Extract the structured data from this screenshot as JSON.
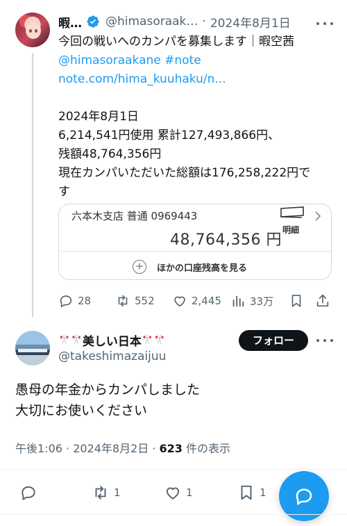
{
  "parent_tweet": {
    "name": "暇…",
    "handle": "@himasoraak…",
    "dot": "·",
    "date": "2024年8月1日",
    "lines": [
      "今回の戦いへのカンパを募集します｜暇空茜",
      "@himasoraakane #note",
      "note.com/hima_kuuhaku/n...",
      "",
      "2024年8月1日",
      "6,214,541円使用 累計127,493,866円、",
      "残額48,764,356円",
      "現在カンパいただいた総額は176,258,222円で",
      "す"
    ],
    "card": {
      "account": "六本木支店 普通 0969443",
      "balance": "48,764,356 円",
      "detail": "明細",
      "other_accounts": "ほかの口座残高を見る"
    },
    "actions": {
      "replies": "28",
      "retweets": "552",
      "likes": "2,445",
      "views": "33万"
    }
  },
  "main_tweet": {
    "flags": "🎌",
    "name": "美しい日本",
    "handle": "@takeshimazaijuu",
    "follow_label": "フォロー",
    "text_lines": [
      "愚母の年金からカンパしました",
      "大切にお使いください"
    ],
    "time": "午後1:06 · 2024年8月2日 · ",
    "views_count": "623",
    "views_label": " 件の表示",
    "actions": {
      "retweets": "1",
      "likes": "1",
      "bookmarks": "1"
    }
  },
  "colors": {
    "accent": "#1d9bf0",
    "text": "#0f1419",
    "muted": "#536471"
  }
}
